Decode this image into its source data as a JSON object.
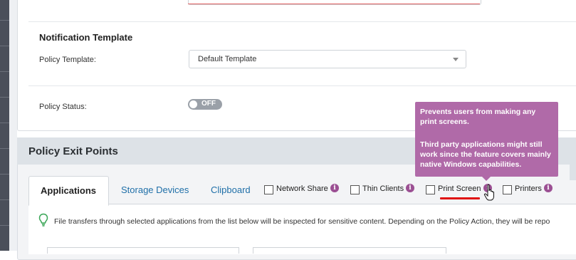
{
  "notification": {
    "section_title": "Notification Template",
    "policy_template_label": "Policy Template:",
    "policy_template_value": "Default Template",
    "policy_status_label": "Policy Status:",
    "policy_status_toggle": "OFF"
  },
  "exit_points": {
    "title": "Policy Exit Points",
    "tabs": [
      {
        "label": "Applications",
        "active": true
      },
      {
        "label": "Storage Devices",
        "active": false
      },
      {
        "label": "Clipboard",
        "active": false
      }
    ],
    "checkboxes": [
      {
        "label": "Network Share",
        "checked": false
      },
      {
        "label": "Thin Clients",
        "checked": false
      },
      {
        "label": "Print Screen",
        "checked": false
      },
      {
        "label": "Printers",
        "checked": false
      }
    ],
    "info_glyph": "i",
    "notice": "File transfers through selected applications from the list below will be inspected for sensitive content. Depending on the Policy Action, they will be repo"
  },
  "tooltip": {
    "line1": "Prevents users from making any print screens.",
    "line2": "Third party applications might still work since the feature covers mainly native Windows capabilities."
  },
  "colors": {
    "accent_link": "#1f6fa8",
    "tooltip_bg": "#b06aa8",
    "info_icon": "#9b4f93",
    "highlight_underline": "#e01010",
    "toggle_off": "#9aa0a8"
  },
  "icons": {
    "info": "info-circle-icon",
    "bulb": "lightbulb-icon",
    "cursor": "hand-pointer-icon",
    "caret": "chevron-down-icon"
  }
}
